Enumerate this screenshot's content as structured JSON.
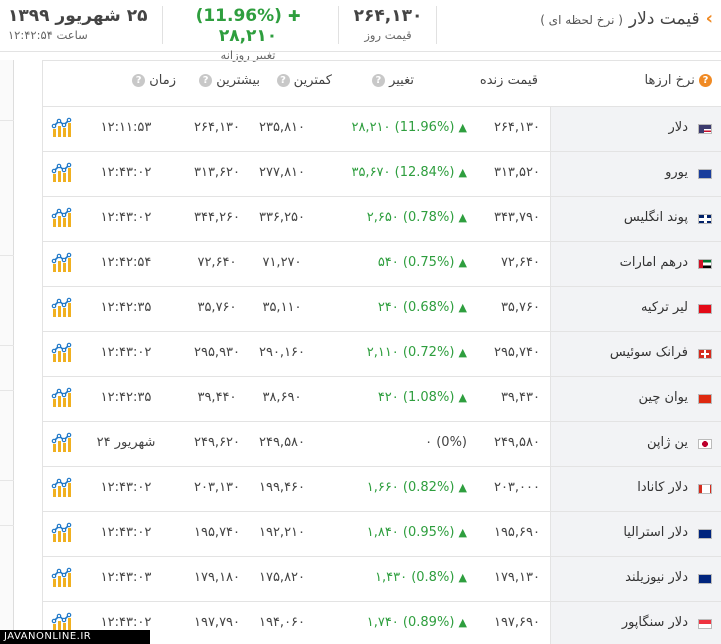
{
  "header": {
    "title": "قیمت دلار",
    "subtitle": "( نرخ لحظه ای )",
    "price_value": "۲۶۴,۱۳۰",
    "price_label": "قیمت روز",
    "change_value": "(11.96%) ۲۸,۲۱۰",
    "change_label": "تغییر روزانه",
    "date_value": "۲۵ شهریور ۱۳۹۹",
    "time_value": "ساعت ۱۲:۴۲:۵۴"
  },
  "table": {
    "headers": {
      "currency": "نرخ ارزها",
      "live": "قیمت زنده",
      "change": "تغییر",
      "min": "کمترین",
      "max": "بیشترین",
      "time": "زمان"
    },
    "rows": [
      {
        "name": "دلار",
        "flag": "us-flag-icon",
        "live": "۲۶۴,۱۳۰",
        "change": "(11.96%) ۲۸,۲۱۰",
        "min": "۲۳۵,۸۱۰",
        "max": "۲۶۴,۱۳۰",
        "time": "۱۲:۱۱:۵۳"
      },
      {
        "name": "یورو",
        "flag": "eu-flag-icon",
        "live": "۳۱۳,۵۲۰",
        "change": "(12.84%) ۳۵,۶۷۰",
        "min": "۲۷۷,۸۱۰",
        "max": "۳۱۳,۶۲۰",
        "time": "۱۲:۴۳:۰۲"
      },
      {
        "name": "پوند انگلیس",
        "flag": "uk-flag-icon",
        "live": "۳۴۳,۷۹۰",
        "change": "(0.78%) ۲,۶۵۰",
        "min": "۳۳۶,۲۵۰",
        "max": "۳۴۴,۲۶۰",
        "time": "۱۲:۴۳:۰۲"
      },
      {
        "name": "درهم امارات",
        "flag": "uae-flag-icon",
        "live": "۷۲,۶۴۰",
        "change": "(0.75%) ۵۴۰",
        "min": "۷۱,۲۷۰",
        "max": "۷۲,۶۴۰",
        "time": "۱۲:۴۲:۵۴"
      },
      {
        "name": "لیر ترکیه",
        "flag": "turkey-flag-icon",
        "live": "۳۵,۷۶۰",
        "change": "(0.68%) ۲۴۰",
        "min": "۳۵,۱۱۰",
        "max": "۳۵,۷۶۰",
        "time": "۱۲:۴۲:۳۵"
      },
      {
        "name": "فرانک سوئیس",
        "flag": "swiss-flag-icon",
        "live": "۲۹۵,۷۴۰",
        "change": "(0.72%) ۲,۱۱۰",
        "min": "۲۹۰,۱۶۰",
        "max": "۲۹۵,۹۳۰",
        "time": "۱۲:۴۳:۰۲"
      },
      {
        "name": "یوان چین",
        "flag": "china-flag-icon",
        "live": "۳۹,۴۳۰",
        "change": "(1.08%) ۴۲۰",
        "min": "۳۸,۶۹۰",
        "max": "۳۹,۴۴۰",
        "time": "۱۲:۴۲:۳۵"
      },
      {
        "name": "ین ژاپن",
        "flag": "japan-flag-icon",
        "live": "۲۴۹,۵۸۰",
        "change": "(0%) ۰",
        "min": "۲۴۹,۵۸۰",
        "max": "۲۴۹,۶۲۰",
        "time": "۲۴ شهریور"
      },
      {
        "name": "دلار کانادا",
        "flag": "canada-flag-icon",
        "live": "۲۰۳,۰۰۰",
        "change": "(0.82%) ۱,۶۶۰",
        "min": "۱۹۹,۴۶۰",
        "max": "۲۰۳,۱۳۰",
        "time": "۱۲:۴۳:۰۲"
      },
      {
        "name": "دلار استرالیا",
        "flag": "australia-flag-icon",
        "live": "۱۹۵,۶۹۰",
        "change": "(0.95%) ۱,۸۴۰",
        "min": "۱۹۲,۲۱۰",
        "max": "۱۹۵,۷۴۰",
        "time": "۱۲:۴۳:۰۲"
      },
      {
        "name": "دلار نیوزیلند",
        "flag": "nz-flag-icon",
        "live": "۱۷۹,۱۳۰",
        "change": "(0.8%) ۱,۴۳۰",
        "min": "۱۷۵,۸۲۰",
        "max": "۱۷۹,۱۸۰",
        "time": "۱۲:۴۳:۰۳"
      },
      {
        "name": "دلار سنگاپور",
        "flag": "singapore-flag-icon",
        "live": "۱۹۷,۶۹۰",
        "change": "(0.89%) ۱,۷۴۰",
        "min": "۱۹۴,۰۶۰",
        "max": "۱۹۷,۷۹۰",
        "time": "۱۲:۴۳:۰۲"
      }
    ]
  },
  "watermark": "JAVANONLINE.IR",
  "colors": {
    "accent": "#f08a24",
    "positive": "#2e9e3e",
    "name_bg": "#f2f3f5"
  }
}
